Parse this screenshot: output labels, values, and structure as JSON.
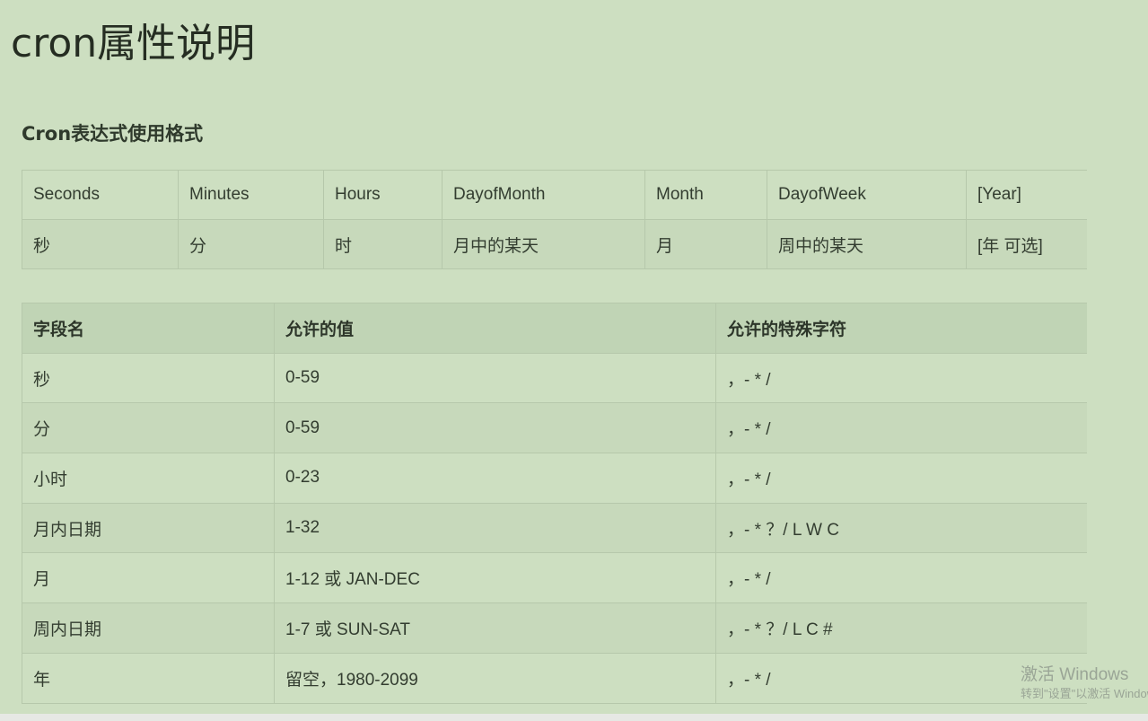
{
  "page": {
    "title": "cron属性说明",
    "subtitle": "Cron表达式使用格式"
  },
  "format_table": {
    "rows": [
      [
        "Seconds",
        "Minutes",
        "Hours",
        "DayofMonth",
        "Month",
        "DayofWeek",
        "[Year]"
      ],
      [
        "秒",
        "分",
        "时",
        "月中的某天",
        "月",
        "周中的某天",
        "[年 可选]"
      ]
    ]
  },
  "fields_table": {
    "headers": [
      "字段名",
      "允许的值",
      "允许的特殊字符"
    ],
    "rows": [
      [
        "秒",
        "0-59",
        "，- * /"
      ],
      [
        "分",
        "0-59",
        "，- * /"
      ],
      [
        "小时",
        "0-23",
        "，- * /"
      ],
      [
        "月内日期",
        "1-32",
        "，- * ？/ L W C"
      ],
      [
        "月",
        "1-12 或 JAN-DEC",
        "，- * /"
      ],
      [
        "周内日期",
        "1-7 或 SUN-SAT",
        "，- * ？/ L C #"
      ],
      [
        "年",
        "留空，1980-2099",
        "，- * /"
      ]
    ]
  },
  "watermark": {
    "line1": "激活 Windows",
    "line2": "转到\"设置\"以激活 Windows。"
  }
}
